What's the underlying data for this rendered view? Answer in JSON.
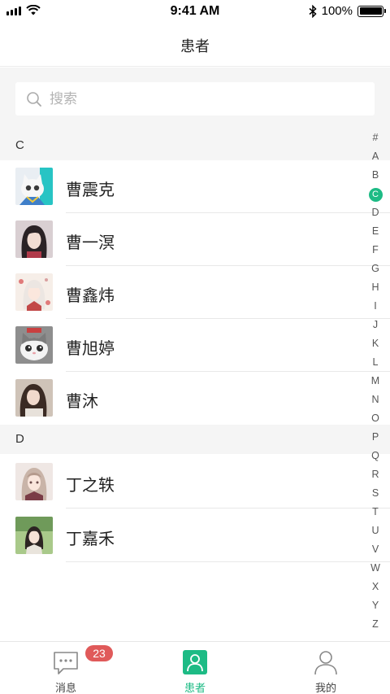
{
  "status_bar": {
    "time": "9:41 AM",
    "battery": "100%"
  },
  "nav": {
    "title": "患者"
  },
  "search": {
    "placeholder": "搜索"
  },
  "sections": [
    {
      "letter": "C",
      "contacts": [
        {
          "name": "曹震克",
          "avatar": "cat-avatar"
        },
        {
          "name": "曹一溟",
          "avatar": "girl-portrait-avatar"
        },
        {
          "name": "曹鑫炜",
          "avatar": "anime-girl-avatar"
        },
        {
          "name": "曹旭婷",
          "avatar": "cat-avatar"
        },
        {
          "name": "曹沐",
          "avatar": "girl-portrait-avatar"
        }
      ]
    },
    {
      "letter": "D",
      "contacts": [
        {
          "name": "丁之轶",
          "avatar": "anime-girl-avatar"
        },
        {
          "name": "丁嘉禾",
          "avatar": "anime-girl-avatar"
        }
      ]
    }
  ],
  "index_letters": [
    "#",
    "A",
    "B",
    "C",
    "D",
    "E",
    "F",
    "G",
    "H",
    "I",
    "J",
    "K",
    "L",
    "M",
    "N",
    "O",
    "P",
    "Q",
    "R",
    "S",
    "T",
    "U",
    "V",
    "W",
    "X",
    "Y",
    "Z"
  ],
  "index_active": "C",
  "tabs": [
    {
      "label": "消息",
      "icon": "message-icon",
      "badge": "23"
    },
    {
      "label": "患者",
      "icon": "patient-icon",
      "active": true
    },
    {
      "label": "我的",
      "icon": "profile-icon"
    }
  ],
  "colors": {
    "accent": "#1dbb85",
    "badge": "#e05a5a",
    "section_bg": "#f5f5f5"
  }
}
